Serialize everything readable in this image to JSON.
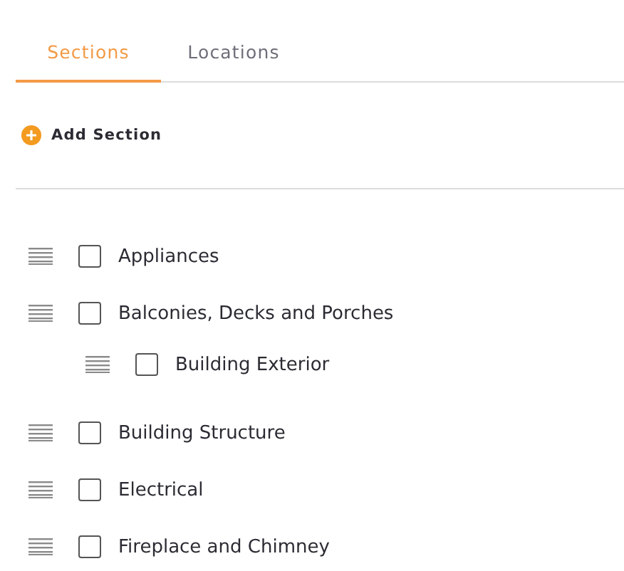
{
  "tabs": [
    {
      "label": "Sections",
      "selected": true
    },
    {
      "label": "Locations",
      "selected": false
    }
  ],
  "add_button": {
    "label": "Add Section"
  },
  "sections": [
    {
      "label": "Appliances",
      "checked": false
    },
    {
      "label": "Balconies, Decks and Porches",
      "checked": false,
      "children": [
        {
          "label": "Building Exterior",
          "checked": false
        }
      ]
    },
    {
      "label": "Building Structure",
      "checked": false
    },
    {
      "label": "Electrical",
      "checked": false
    },
    {
      "label": "Fireplace and Chimney",
      "checked": false
    }
  ]
}
